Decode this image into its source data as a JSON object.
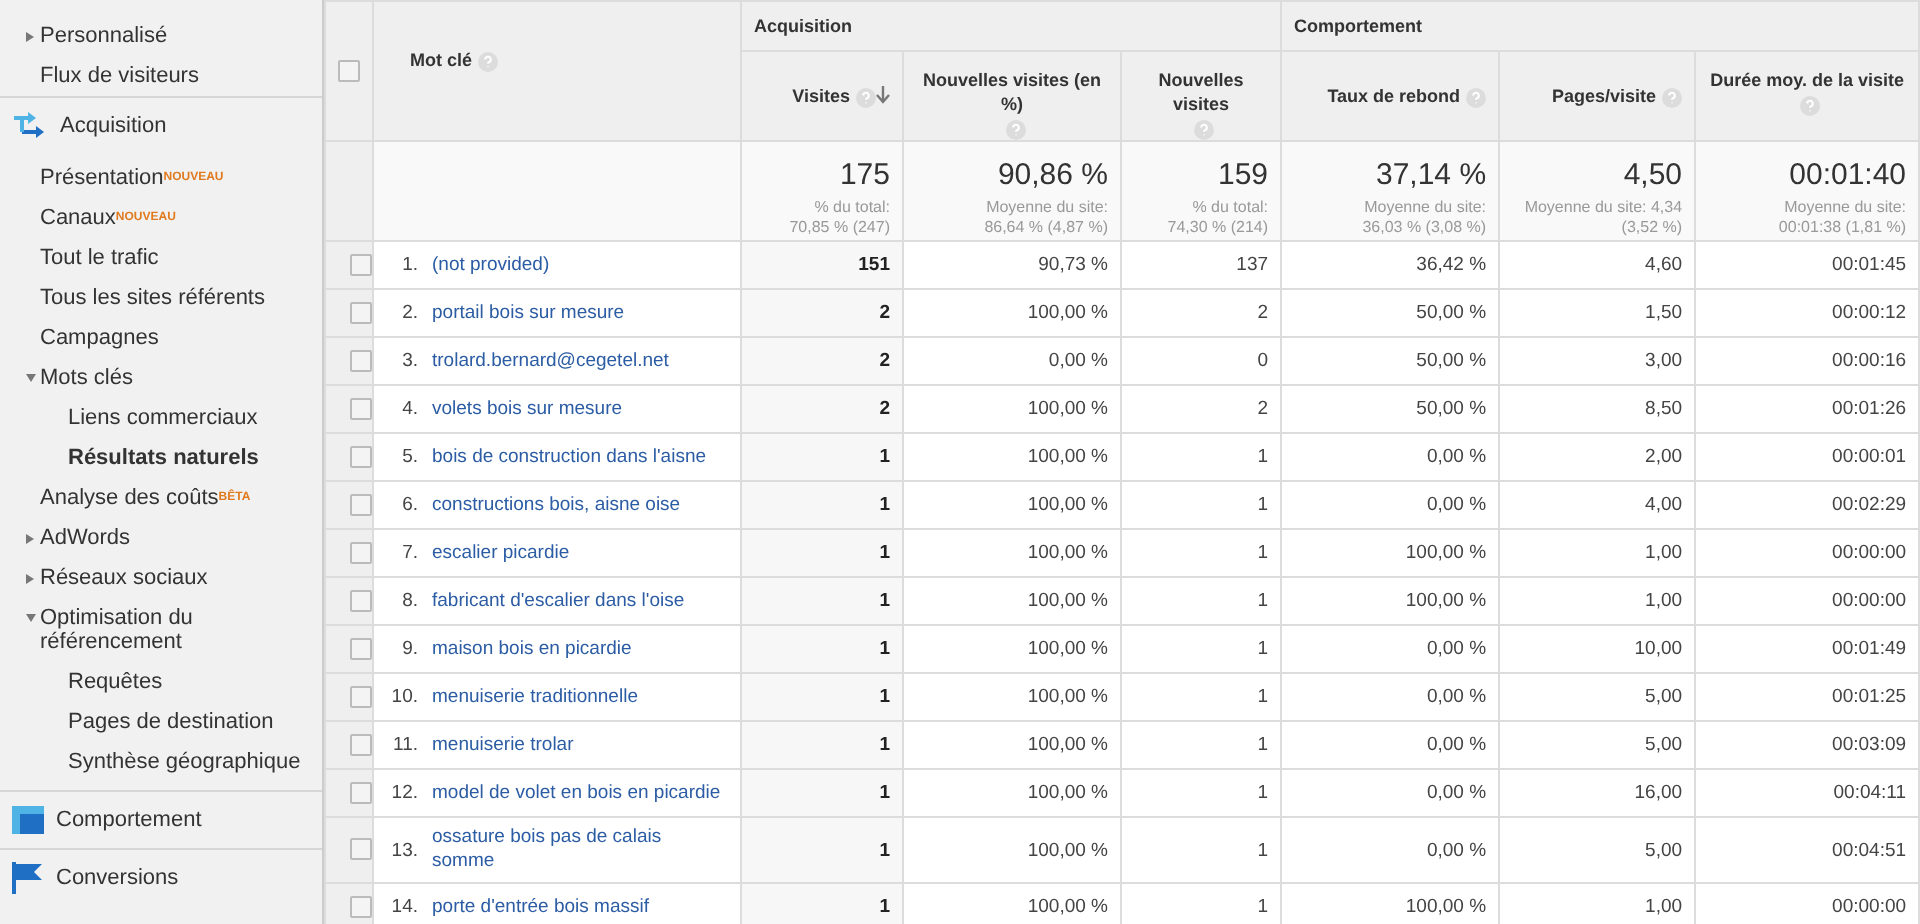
{
  "sidebar": {
    "top_items": [
      {
        "label": "Personnalisé",
        "kind": "folder",
        "expanded": false,
        "selected": false
      },
      {
        "label": "Flux de visiteurs",
        "kind": "link",
        "selected": false
      }
    ],
    "sections": [
      {
        "title": "Acquisition",
        "items": [
          {
            "label": "Présentation",
            "badge": "NOUVEAU",
            "kind": "link",
            "selected": false
          },
          {
            "label": "Canaux",
            "badge": "NOUVEAU",
            "kind": "link",
            "selected": false
          },
          {
            "label": "Tout le trafic",
            "kind": "link",
            "selected": false
          },
          {
            "label": "Tous les sites référents",
            "kind": "link",
            "selected": false
          },
          {
            "label": "Campagnes",
            "kind": "link",
            "selected": false
          },
          {
            "label": "Mots clés",
            "kind": "folder",
            "expanded": true,
            "selected": false,
            "children": [
              {
                "label": "Liens commerciaux",
                "kind": "link",
                "selected": false
              },
              {
                "label": "Résultats naturels",
                "kind": "link",
                "selected": true
              }
            ]
          },
          {
            "label": "Analyse des coûts",
            "badge": "BÊTA",
            "kind": "link",
            "selected": false
          },
          {
            "label": "AdWords",
            "kind": "folder",
            "expanded": false,
            "selected": false
          },
          {
            "label": "Réseaux sociaux",
            "kind": "folder",
            "expanded": false,
            "selected": false
          },
          {
            "label": "Optimisation du référencement",
            "kind": "folder",
            "expanded": true,
            "selected": false,
            "children": [
              {
                "label": "Requêtes",
                "kind": "link",
                "selected": false
              },
              {
                "label": "Pages de destination",
                "kind": "link",
                "selected": false
              },
              {
                "label": "Synthèse géographique",
                "kind": "link",
                "selected": false
              }
            ]
          }
        ]
      },
      {
        "title": "Comportement"
      },
      {
        "title": "Conversions"
      }
    ]
  },
  "table": {
    "select_all_checked": false,
    "keyword_header": "Mot clé",
    "groups": [
      {
        "label": "Acquisition",
        "columns": [
          {
            "label": "Visites",
            "sorted": true
          },
          {
            "label": "Nouvelles visites (en %)",
            "sorted": false
          },
          {
            "label": "Nouvelles visites",
            "sorted": false
          }
        ]
      },
      {
        "label": "Comportement",
        "columns": [
          {
            "label": "Taux de rebond",
            "sorted": false
          },
          {
            "label": "Pages/visite",
            "sorted": false
          },
          {
            "label": "Durée moy. de la visite",
            "sorted": false
          }
        ]
      }
    ],
    "totals": [
      {
        "value": "175",
        "note_lines": [
          "% du total:",
          "70,85 % (247)"
        ]
      },
      {
        "value": "90,86 %",
        "note_lines": [
          "Moyenne du site:",
          "86,64 % (4,87 %)"
        ]
      },
      {
        "value": "159",
        "note_lines": [
          "% du total:",
          "74,30 % (214)"
        ]
      },
      {
        "value": "37,14 %",
        "note_lines": [
          "Moyenne du site:",
          "36,03 % (3,08 %)"
        ]
      },
      {
        "value": "4,50",
        "note_lines": [
          "Moyenne du site: 4,34",
          "(3,52 %)"
        ]
      },
      {
        "value": "00:01:40",
        "note_lines": [
          "Moyenne du site:",
          "00:01:38 (1,81 %)"
        ]
      }
    ],
    "rows": [
      {
        "rank": "1.",
        "keyword": "(not provided)",
        "checked": false,
        "values": [
          "151",
          "90,73 %",
          "137",
          "36,42 %",
          "4,60",
          "00:01:45"
        ]
      },
      {
        "rank": "2.",
        "keyword": "portail bois sur mesure",
        "checked": false,
        "values": [
          "2",
          "100,00 %",
          "2",
          "50,00 %",
          "1,50",
          "00:00:12"
        ]
      },
      {
        "rank": "3.",
        "keyword": "trolard.bernard@cegetel.net",
        "checked": false,
        "values": [
          "2",
          "0,00 %",
          "0",
          "50,00 %",
          "3,00",
          "00:00:16"
        ]
      },
      {
        "rank": "4.",
        "keyword": "volets bois sur mesure",
        "checked": false,
        "values": [
          "2",
          "100,00 %",
          "2",
          "50,00 %",
          "8,50",
          "00:01:26"
        ]
      },
      {
        "rank": "5.",
        "keyword": "bois de construction dans l'aisne",
        "checked": false,
        "values": [
          "1",
          "100,00 %",
          "1",
          "0,00 %",
          "2,00",
          "00:00:01"
        ]
      },
      {
        "rank": "6.",
        "keyword": "constructions bois, aisne oise",
        "checked": false,
        "values": [
          "1",
          "100,00 %",
          "1",
          "0,00 %",
          "4,00",
          "00:02:29"
        ]
      },
      {
        "rank": "7.",
        "keyword": "escalier picardie",
        "checked": false,
        "values": [
          "1",
          "100,00 %",
          "1",
          "100,00 %",
          "1,00",
          "00:00:00"
        ]
      },
      {
        "rank": "8.",
        "keyword": "fabricant d'escalier dans l'oise",
        "checked": false,
        "values": [
          "1",
          "100,00 %",
          "1",
          "100,00 %",
          "1,00",
          "00:00:00"
        ]
      },
      {
        "rank": "9.",
        "keyword": "maison bois en picardie",
        "checked": false,
        "values": [
          "1",
          "100,00 %",
          "1",
          "0,00 %",
          "10,00",
          "00:01:49"
        ]
      },
      {
        "rank": "10.",
        "keyword": "menuiserie traditionnelle",
        "checked": false,
        "values": [
          "1",
          "100,00 %",
          "1",
          "0,00 %",
          "5,00",
          "00:01:25"
        ]
      },
      {
        "rank": "11.",
        "keyword": "menuiserie trolar",
        "checked": false,
        "values": [
          "1",
          "100,00 %",
          "1",
          "0,00 %",
          "5,00",
          "00:03:09"
        ]
      },
      {
        "rank": "12.",
        "keyword": "model de volet en bois en picardie",
        "checked": false,
        "values": [
          "1",
          "100,00 %",
          "1",
          "0,00 %",
          "16,00",
          "00:04:11"
        ]
      },
      {
        "rank": "13.",
        "keyword": "ossature bois pas de calais somme",
        "checked": false,
        "values": [
          "1",
          "100,00 %",
          "1",
          "0,00 %",
          "5,00",
          "00:04:51"
        ]
      },
      {
        "rank": "14.",
        "keyword": "porte d'entrée bois massif",
        "checked": false,
        "values": [
          "1",
          "100,00 %",
          "1",
          "100,00 %",
          "1,00",
          "00:00:00"
        ]
      }
    ]
  }
}
